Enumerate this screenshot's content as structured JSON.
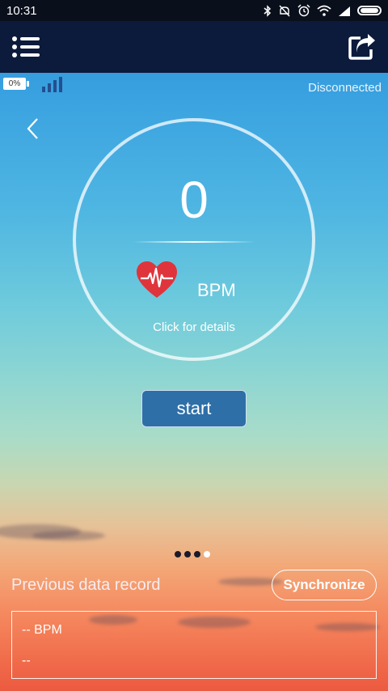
{
  "status_bar": {
    "time": "10:31"
  },
  "device": {
    "battery_label": "0%",
    "connection_status": "Disconnected"
  },
  "reading": {
    "value": "0",
    "unit": "BPM",
    "details_link": "Click for details"
  },
  "actions": {
    "start_label": "start",
    "sync_label": "Synchronize"
  },
  "pager": {
    "count": 4,
    "active_index": 3
  },
  "history": {
    "title": "Previous data record",
    "record": {
      "bpm_text": "-- BPM",
      "time_text": "--"
    }
  },
  "colors": {
    "app_bar": "#0c1a3c",
    "start_button": "#2e6fa8",
    "heart": "#e0343c"
  },
  "icons": [
    "menu-icon",
    "share-icon",
    "back-chevron-icon",
    "heart-pulse-icon",
    "bluetooth-icon",
    "alarm-icon",
    "wifi-icon",
    "signal-icon",
    "battery-icon"
  ]
}
